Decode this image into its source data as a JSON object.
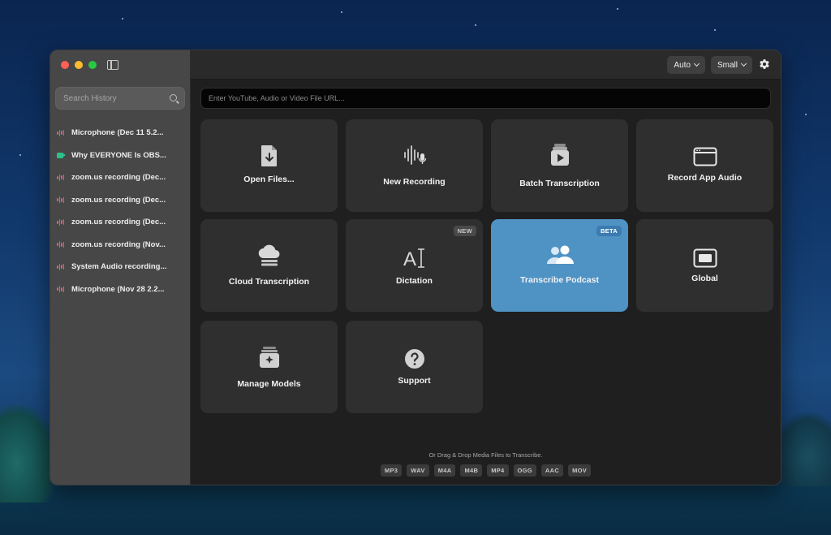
{
  "sidebar": {
    "search_placeholder": "Search History",
    "items": [
      {
        "label": "Microphone (Dec 11 5.2...",
        "icon": "waveform-icon"
      },
      {
        "label": "Why EVERYONE Is OBS...",
        "icon": "video-icon"
      },
      {
        "label": "zoom.us recording (Dec...",
        "icon": "waveform-icon"
      },
      {
        "label": "zoom.us recording (Dec...",
        "icon": "waveform-icon"
      },
      {
        "label": "zoom.us recording (Dec...",
        "icon": "waveform-icon"
      },
      {
        "label": "zoom.us recording (Nov...",
        "icon": "waveform-icon"
      },
      {
        "label": "System Audio recording...",
        "icon": "waveform-icon"
      },
      {
        "label": "Microphone (Nov 28 2.2...",
        "icon": "waveform-icon"
      }
    ]
  },
  "toolbar": {
    "language_value": "Auto",
    "model_value": "Small"
  },
  "url_input": {
    "placeholder": "Enter YouTube, Audio or Video File URL..."
  },
  "tiles": [
    {
      "label": "Open Files...",
      "icon": "file-download-icon"
    },
    {
      "label": "New Recording",
      "icon": "waveform-mic-icon"
    },
    {
      "label": "Batch Transcription",
      "icon": "stacked-play-icon"
    },
    {
      "label": "Record App Audio",
      "icon": "app-window-icon"
    },
    {
      "label": "Cloud Transcription",
      "icon": "cloud-server-icon"
    },
    {
      "label": "Dictation",
      "icon": "text-cursor-icon",
      "badge": "NEW"
    },
    {
      "label": "Transcribe Podcast",
      "icon": "people-icon",
      "badge": "BETA"
    },
    {
      "label": "Global",
      "icon": "display-icon"
    },
    {
      "label": "Manage Models",
      "icon": "sparkle-stack-icon"
    },
    {
      "label": "Support",
      "icon": "question-icon"
    }
  ],
  "footer": {
    "hint": "Or Drag & Drop Media Files to Transcribe.",
    "formats": [
      "MP3",
      "WAV",
      "M4A",
      "M4B",
      "MP4",
      "OGG",
      "AAC",
      "MOV"
    ]
  },
  "colors": {
    "accent": "#4f93c5",
    "waveform": "#e55a7b",
    "video": "#2cc08a"
  }
}
